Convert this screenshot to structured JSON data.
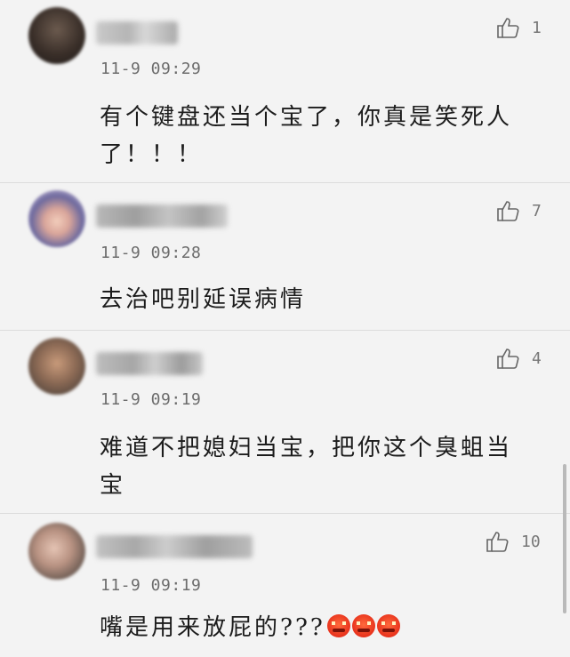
{
  "comments": [
    {
      "username": "",
      "time": "11-9 09:29",
      "text": "有个键盘还当个宝了，你真是笑死人了！！！",
      "likes": "1"
    },
    {
      "username": "",
      "time": "11-9 09:28",
      "text": "去治吧别延误病情",
      "likes": "7"
    },
    {
      "username": "",
      "time": "11-9 09:19",
      "text": "难道不把媳妇当宝，把你这个臭蛆当宝",
      "likes": "4"
    },
    {
      "username": "",
      "time": "11-9 09:19",
      "text": "嘴是用来放屁的???",
      "likes": "10",
      "emojis": [
        "angry-face-emoji",
        "angry-face-emoji",
        "angry-face-emoji"
      ]
    }
  ],
  "colors": {
    "background": "#f3f3f3",
    "text": "#1c1c1c",
    "meta": "#6c6c6c",
    "divider": "#dcdcdc",
    "emoji": "#e8321c"
  }
}
